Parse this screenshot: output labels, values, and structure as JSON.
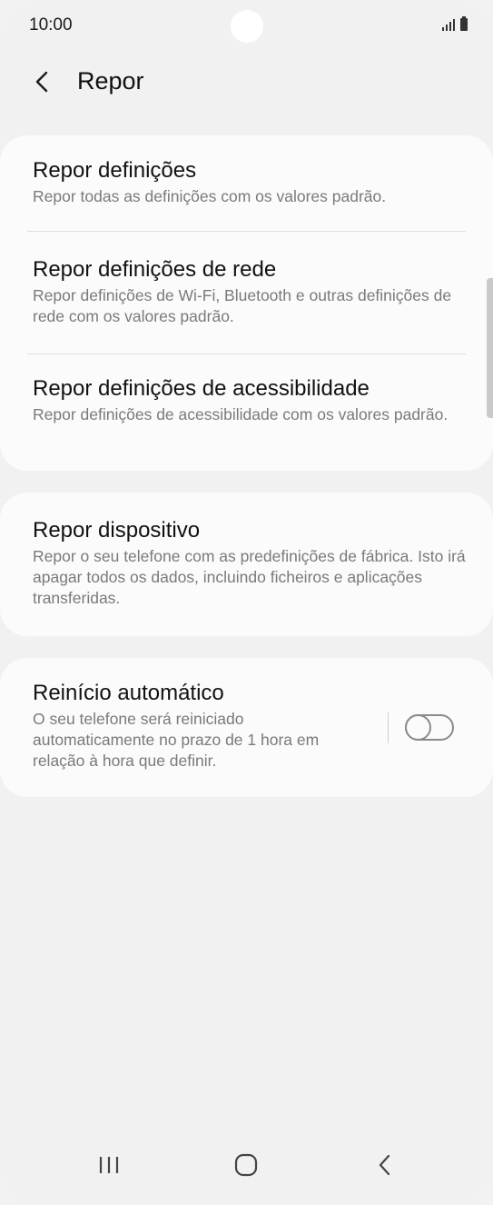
{
  "status_bar": {
    "time": "10:00"
  },
  "app_bar": {
    "title": "Repor",
    "back_icon": "chevron-left-icon"
  },
  "reset_options": [
    {
      "title": "Repor definições",
      "description": "Repor todas as definições com os valores padrão."
    },
    {
      "title": "Repor definições de rede",
      "description": "Repor definições de Wi-Fi, Bluetooth e outras definições de rede com os valores padrão."
    },
    {
      "title": "Repor definições de acessibilidade",
      "description": "Repor definições de acessibilidade com os valores padrão."
    }
  ],
  "factory_reset": {
    "title": "Repor dispositivo",
    "description": "Repor o seu telefone com as predefinições de fábrica. Isto irá apagar todos os dados, incluindo ficheiros e aplicações transferidas."
  },
  "auto_restart": {
    "title": "Reinício automático",
    "description": "O seu telefone será reiniciado automaticamente no prazo de 1 hora em relação à hora que definir.",
    "enabled": false
  },
  "nav_bar": {
    "recent_icon": "recent-apps-icon",
    "home_icon": "home-icon",
    "back_icon": "back-icon"
  },
  "colors": {
    "background": "#f1f1f1",
    "card": "#fbfbfb",
    "title_text": "#111111",
    "secondary_text": "#7a7a7a",
    "toggle_off": "#8a8a8a"
  }
}
